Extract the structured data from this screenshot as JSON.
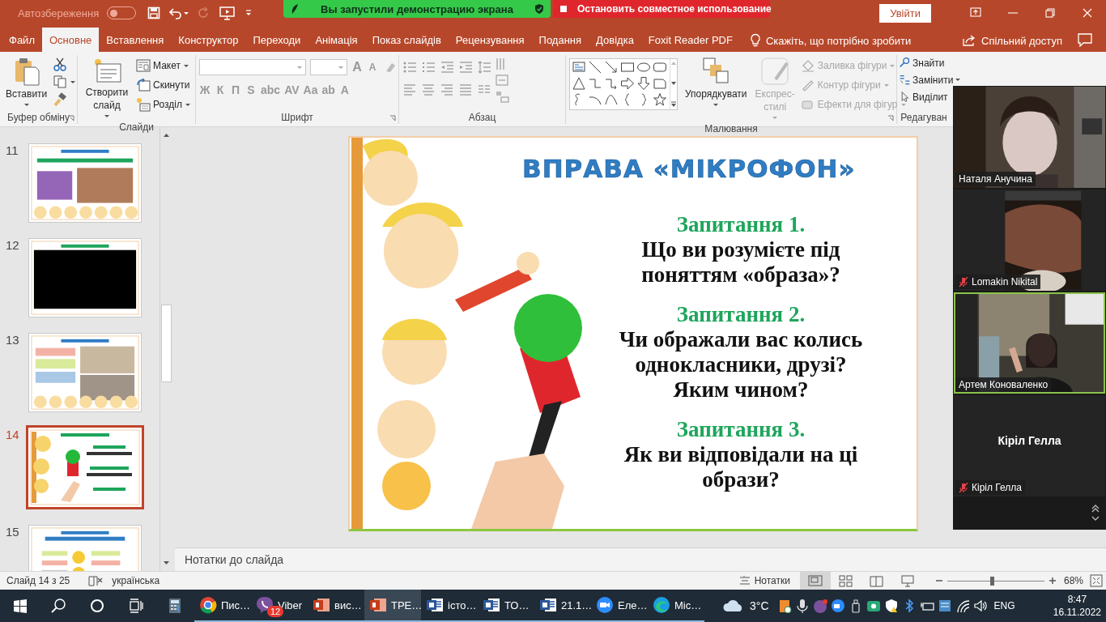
{
  "title_bar": {
    "autosave_label": "Автозбереження",
    "autosave_on": false,
    "signin_button": "Увійти"
  },
  "share_banner": {
    "message": "Вы запустили демонстрацию экрана",
    "stop_button": "Остановить совместное использование"
  },
  "tabs": [
    {
      "label": "Файл",
      "selected": false
    },
    {
      "label": "Основне",
      "selected": true
    },
    {
      "label": "Вставлення",
      "selected": false
    },
    {
      "label": "Конструктор",
      "selected": false
    },
    {
      "label": "Переходи",
      "selected": false
    },
    {
      "label": "Анімація",
      "selected": false
    },
    {
      "label": "Показ слайдів",
      "selected": false
    },
    {
      "label": "Рецензування",
      "selected": false
    },
    {
      "label": "Подання",
      "selected": false
    },
    {
      "label": "Довідка",
      "selected": false
    },
    {
      "label": "Foxit Reader PDF",
      "selected": false
    }
  ],
  "tell_me": "Скажіть, що потрібно зробити",
  "share_button": "Спільний доступ",
  "ribbon": {
    "clipboard": {
      "paste": "Вставити",
      "label": "Буфер обміну"
    },
    "slides": {
      "new_slide": "Створити слайд",
      "items": [
        "Макет",
        "Скинути",
        "Розділ"
      ],
      "label": "Слайди"
    },
    "font": {
      "disabled": true,
      "size_buttons": [
        "A",
        "A"
      ],
      "buttons": [
        "Ж",
        "К",
        "П",
        "S",
        "abc",
        "AV",
        "Aa",
        "ab",
        "A"
      ],
      "label": "Шрифт"
    },
    "paragraph": {
      "label": "Абзац"
    },
    "drawing": {
      "arrange": "Упорядкувати",
      "quick_styles": {
        "label": "Експрес-стилі",
        "disabled": true
      },
      "format_items": [
        {
          "label": "Заливка фігури",
          "disabled": true
        },
        {
          "label": "Контур фігури",
          "disabled": true
        },
        {
          "label": "Ефекти для фігур",
          "disabled": true
        }
      ],
      "label": "Малювання"
    },
    "editing": {
      "items": [
        "Знайти",
        "Замінити",
        "Виділит"
      ],
      "label": "Редагуван"
    }
  },
  "slides_pane": [
    {
      "number": "11",
      "selected": false
    },
    {
      "number": "12",
      "selected": false
    },
    {
      "number": "13",
      "selected": false
    },
    {
      "number": "14",
      "selected": true
    },
    {
      "number": "15",
      "selected": false
    }
  ],
  "slide": {
    "title": "ВПРАВА «МІКРОФОН»",
    "questions": [
      {
        "heading": "Запитання 1.",
        "text": "Що ви розумієте під поняттям «образа»?"
      },
      {
        "heading": "Запитання 2.",
        "text": "Чи ображали вас колись однокласники, друзі? Яким чином?"
      },
      {
        "heading": "Запитання 3.",
        "text": "Як ви відповідали на ці образи?"
      }
    ]
  },
  "notes": {
    "placeholder": "Нотатки до слайда"
  },
  "status_bar": {
    "slide_info": "Слайд 14 з 25",
    "language": "українська",
    "notes_button": "Нотатки",
    "views": [
      {
        "kind": "normal",
        "selected": true
      },
      {
        "kind": "sorter",
        "selected": false
      },
      {
        "kind": "reading",
        "selected": false
      },
      {
        "kind": "slideshow",
        "selected": false
      }
    ],
    "zoom": {
      "level": 0.46
    },
    "zoom_percent": "68%"
  },
  "taskbar": {
    "apps": [
      {
        "kind": "chrome",
        "label": "Пис…",
        "selected": false
      },
      {
        "kind": "viber",
        "label": "Viber",
        "badge": "12",
        "selected": false
      },
      {
        "kind": "powerpoint",
        "label": "вис…",
        "selected": false
      },
      {
        "kind": "powerpoint",
        "label": "ТРЕ…",
        "selected": true
      },
      {
        "kind": "word",
        "label": "істо…",
        "selected": false
      },
      {
        "kind": "word",
        "label": "ТО…",
        "selected": false
      },
      {
        "kind": "word",
        "label": "21.1…",
        "selected": false
      },
      {
        "kind": "zoom",
        "label": "Еле…",
        "selected": false
      },
      {
        "kind": "edge",
        "label": "Mic…",
        "selected": false
      }
    ],
    "weather": "3°C",
    "language": "ENG",
    "time": "8:47",
    "date": "16.11.2022"
  },
  "video_panel": {
    "participants": [
      {
        "name": "Наталя Анучина",
        "video": true,
        "muted": false,
        "speaking": false
      },
      {
        "name": "Lomakin Nikital",
        "video": true,
        "muted": true,
        "speaking": false
      },
      {
        "name": "Артем Коноваленко",
        "video": true,
        "muted": false,
        "speaking": true
      },
      {
        "name": "Кіріл Гелла",
        "display_name": "Кіріл Гелла",
        "video": false,
        "muted": true,
        "speaking": false
      }
    ]
  }
}
